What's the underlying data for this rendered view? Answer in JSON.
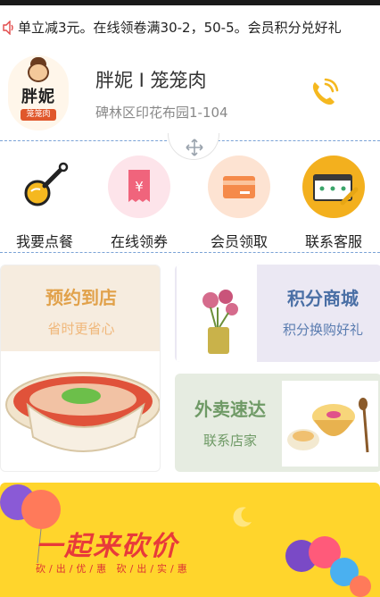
{
  "notice": {
    "text": "单立减3元。在线领卷满30-2，50-5。会员积分兑好礼"
  },
  "store": {
    "logo_text": "胖妮",
    "logo_sub": "笼笼肉",
    "name": "胖妮 I 笼笼肉",
    "address": "碑林区印花布园1-104"
  },
  "nav": {
    "items": [
      {
        "label": "我要点餐",
        "icon": "spoon-icon"
      },
      {
        "label": "在线领券",
        "icon": "coupon-icon"
      },
      {
        "label": "会员领取",
        "icon": "member-card-icon"
      },
      {
        "label": "联系客服",
        "icon": "customer-service-icon"
      }
    ]
  },
  "cards": {
    "reserve": {
      "title": "预约到店",
      "subtitle": "省时更省心"
    },
    "points": {
      "title": "积分商城",
      "subtitle": "积分换购好礼"
    },
    "delivery": {
      "title": "外卖速达",
      "subtitle": "联系店家"
    }
  },
  "banner": {
    "title": "一起来砍价",
    "subtitle": "砍/出/优/惠  砍/出/实/惠"
  },
  "colors": {
    "accent": "#f5b81f",
    "divider": "#7aa2d6",
    "banner_bg": "#ffd52c"
  }
}
